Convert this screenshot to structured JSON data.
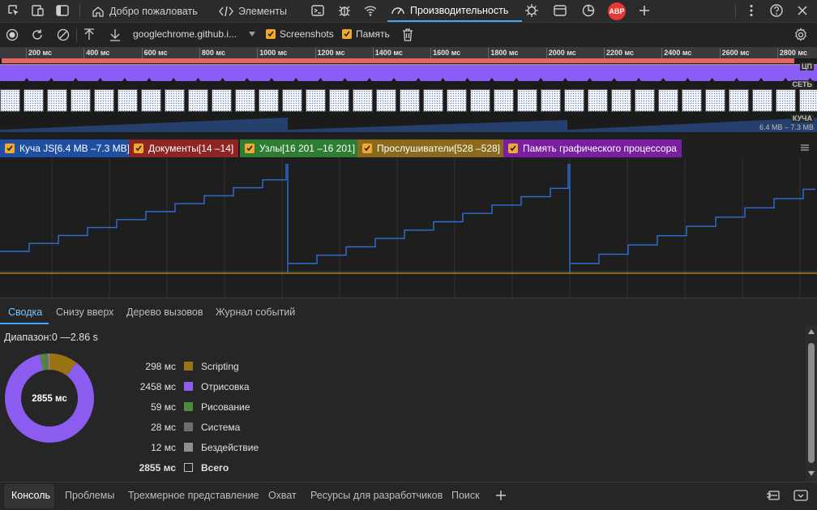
{
  "tabbar": {
    "tabs": [
      {
        "label": "Добро пожаловать"
      },
      {
        "label": "Элементы"
      },
      {
        "label": "Производительность"
      }
    ],
    "abp_label": "ABP"
  },
  "toolbar": {
    "recording_name": "googlechrome.github.i...",
    "screenshots_label": "Screenshots",
    "memory_label": "Память"
  },
  "overview": {
    "ticks": [
      "200 мс",
      "400 мс",
      "600 мс",
      "800 мс",
      "1000 мс",
      "1200 мс",
      "1400 мс",
      "1600 мс",
      "1800 мс",
      "2000 мс",
      "2200 мс",
      "2400 мс",
      "2600 мс",
      "2800 мс"
    ],
    "cpu_label": "ЦП",
    "net_label": "СЕТЬ",
    "heap_label": "КУЧА",
    "heap_range": "6.4 MB – 7.3 MB"
  },
  "legend": {
    "items": [
      {
        "label": "Куча JS[6.4 MB –7.3 MB]",
        "color": "#1f4fa0"
      },
      {
        "label": "Документы[14 –14]",
        "color": "#8e2424"
      },
      {
        "label": "Узлы[16 201 –16 201]",
        "color": "#2e7d32"
      },
      {
        "label": "Прослушиватели[528 –528]",
        "color": "#8a6a1c"
      },
      {
        "label": "Память графического процессора",
        "color": "#7b1fa2"
      }
    ]
  },
  "bottom_tabs": [
    "Сводка",
    "Снизу вверх",
    "Дерево вызовов",
    "Журнал событий"
  ],
  "summary": {
    "range_label": "Диапазон:0 —2.86 s",
    "total_center": "2855 мс",
    "rows": [
      {
        "value": "298 мс",
        "name": "Scripting",
        "color": "#9a7414",
        "ms": 298
      },
      {
        "value": "2458 мс",
        "name": "Отрисовка",
        "color": "#8c5cf0",
        "ms": 2458
      },
      {
        "value": "59 мс",
        "name": "Рисование",
        "color": "#4e8a3c",
        "ms": 59
      },
      {
        "value": "28 мс",
        "name": "Система",
        "color": "#6d6d6d",
        "ms": 28
      },
      {
        "value": "12 мс",
        "name": "Бездействие",
        "color": "#8f8f8f",
        "ms": 12
      },
      {
        "value": "2855 мс",
        "name": "Всего",
        "color": "#262626",
        "ms": 2855
      }
    ]
  },
  "drawer": {
    "tabs": [
      "Консоль",
      "Проблемы",
      "Трехмерное представление",
      "Охват",
      "Ресурсы для разработчиков",
      "Поиск"
    ]
  }
}
